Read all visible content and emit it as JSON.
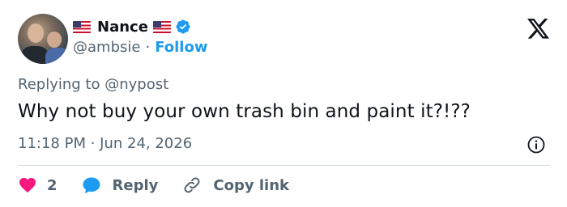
{
  "author": {
    "display_name": "Nance",
    "handle": "@ambsie",
    "follow_label": "Follow",
    "separator": "·"
  },
  "reply_context": {
    "prefix": "Replying to ",
    "target": "@nypost"
  },
  "tweet": {
    "text": "Why not buy your own trash bin and paint it?!??",
    "timestamp": "11:18 PM · Jun 24, 2026"
  },
  "actions": {
    "like_count": "2",
    "reply_label": "Reply",
    "copy_link_label": "Copy link"
  },
  "colors": {
    "accent": "#1d9bf0",
    "heart": "#f91880",
    "muted_text": "#536471",
    "text": "#0f1419",
    "divider": "#cfd9de"
  },
  "icons": [
    "us-flag-icon",
    "verified-badge-icon",
    "x-logo-icon",
    "info-icon",
    "heart-icon",
    "reply-bubble-icon",
    "link-icon"
  ]
}
